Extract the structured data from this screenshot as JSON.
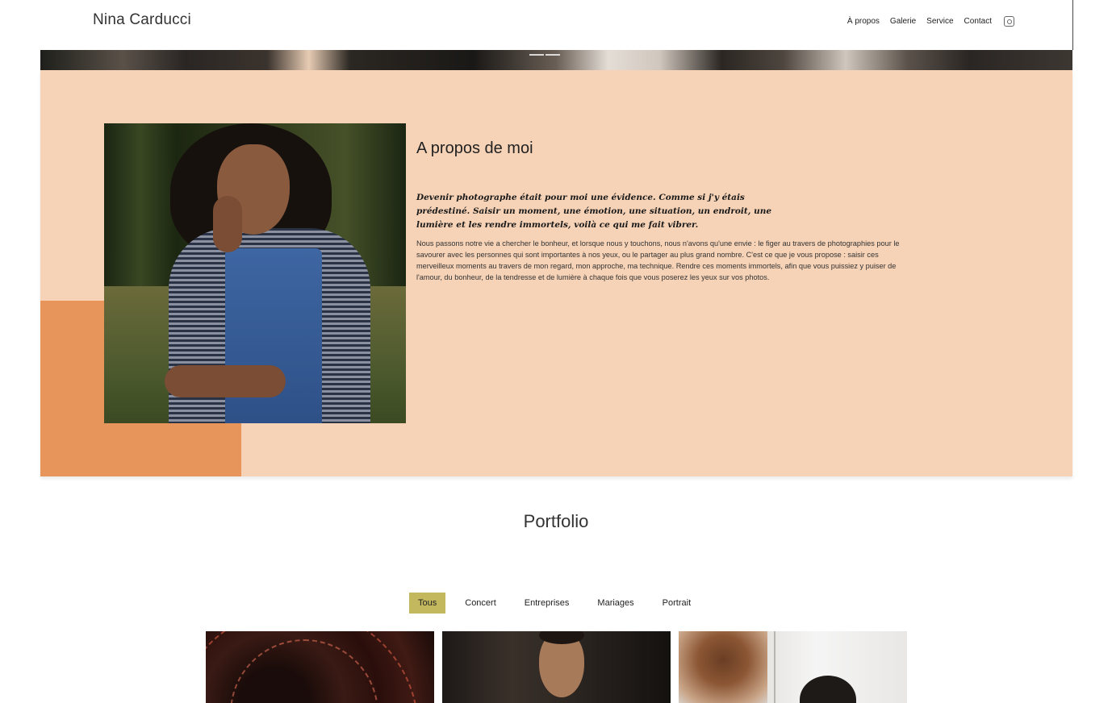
{
  "header": {
    "brand": "Nina Carducci",
    "nav": [
      "À propos",
      "Galerie",
      "Service",
      "Contact"
    ],
    "social_icon": "instagram-icon"
  },
  "about": {
    "title": "A propos de moi",
    "lead": "Devenir photographe était pour moi une évidence. Comme si j'y étais prédestiné. Saisir un moment, une émotion, une situation, un endroit, une lumière et les rendre immortels, voilà ce qui me fait vibrer.",
    "body": "Nous passons notre vie a chercher le bonheur, et lorsque nous y touchons, nous n'avons qu'une envie : le figer au travers de photographies pour le savourer avec les personnes qui sont importantes à nos yeux, ou le partager au plus grand nombre. C'est ce que je vous propose : saisir ces merveilleux moments au travers de mon regard, mon approche, ma technique. Rendre ces moments immortels, afin que vous puissiez y puiser de l'amour, du bonheur, de la tendresse et de lumière à chaque fois que vous poserez les yeux sur vos photos."
  },
  "portfolio": {
    "title": "Portfolio",
    "filters": [
      "Tous",
      "Concert",
      "Entreprises",
      "Mariages",
      "Portrait"
    ],
    "active_filter": "Tous"
  },
  "colors": {
    "about_bg": "#f6d2b6",
    "accent_block": "#e8955c",
    "active_filter": "#c4b85e"
  }
}
